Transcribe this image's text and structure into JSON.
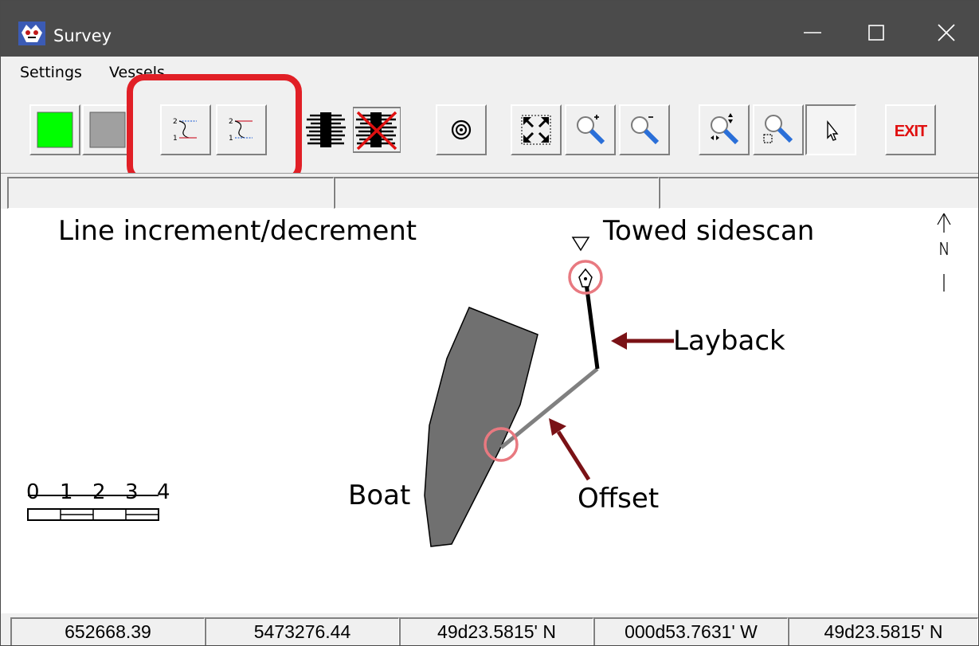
{
  "window": {
    "title": "Survey"
  },
  "menu": {
    "items": [
      "Settings",
      "Vessels"
    ]
  },
  "annotations": {
    "line_incdec": "Line increment/decrement",
    "towed": "Towed sidescan",
    "layback": "Layback",
    "offset": "Offset",
    "boat": "Boat",
    "exit_label": "EXIT"
  },
  "scale": {
    "labels": [
      "0",
      "1",
      "2",
      "3",
      "4"
    ]
  },
  "status": {
    "cells": [
      "652668.39",
      "5473276.44",
      "49d23.5815' N",
      "000d53.7631' W",
      "49d23.5815' N"
    ]
  },
  "icons": [
    "green-square-icon",
    "gray-square-icon",
    "line-increment-icon",
    "line-decrement-icon",
    "sidescan-display-icon",
    "sidescan-off-icon",
    "target-icon",
    "zoom-extents-icon",
    "zoom-in-icon",
    "zoom-out-icon",
    "zoom-pan-icon",
    "zoom-window-icon",
    "pointer-icon",
    "exit-icon"
  ],
  "colors": {
    "highlight": "#e11f26",
    "arrow": "#7a1216",
    "boat": "#707070",
    "active_green": "#00ff00"
  }
}
